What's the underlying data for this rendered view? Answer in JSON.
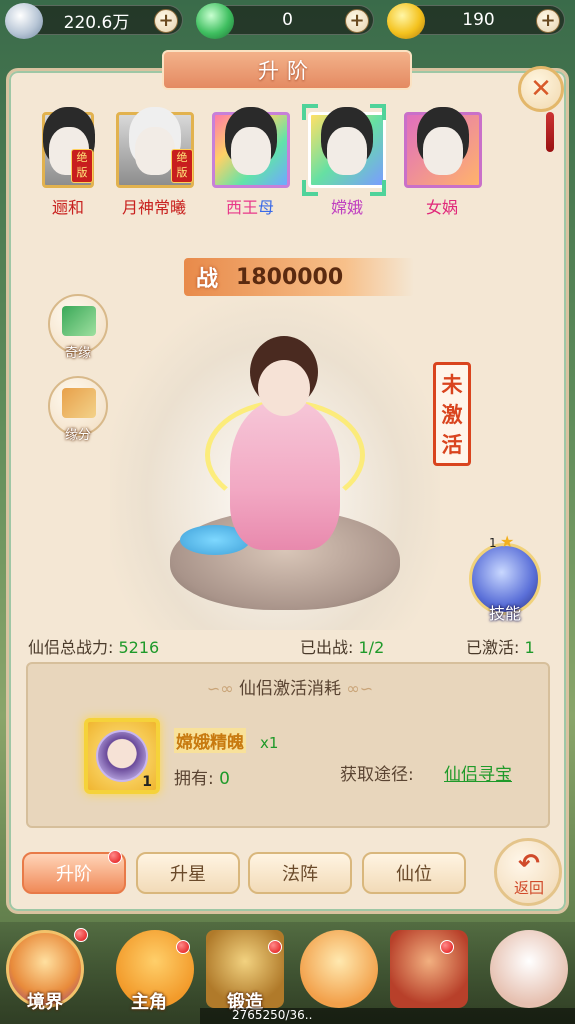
{
  "currency": {
    "silver": "220.6万",
    "jade": "0",
    "gold": "190"
  },
  "title": "升阶",
  "close_icon": "close-x",
  "partners": [
    {
      "name": "逦和",
      "badge": "绝版"
    },
    {
      "name": "月神常曦",
      "badge": "绝版"
    },
    {
      "name_main": "西王",
      "name_tail": "母"
    },
    {
      "name": "嫦娥"
    },
    {
      "name": "女娲"
    }
  ],
  "power": {
    "label": "战",
    "value": "1800000"
  },
  "side": {
    "qiyuan": "奇缘",
    "yuanfen": "缘分"
  },
  "status": {
    "inactive_chars": [
      "未",
      "激",
      "活"
    ]
  },
  "skill": {
    "level": "1",
    "label": "技能"
  },
  "stats": {
    "total_power_label": "仙侣总战力:",
    "total_power_value": "5216",
    "deployed_label": "已出战:",
    "deployed_value": "1/2",
    "activated_label": "已激活:",
    "activated_value": "1"
  },
  "cost": {
    "title": "仙侣激活消耗",
    "item_name": "嫦娥精魄",
    "item_count": "x1",
    "item_slot_qty": "1",
    "owned_label": "拥有:",
    "owned_value": "0",
    "source_label": "获取途径:",
    "source_link": "仙侣寻宝"
  },
  "tabs": [
    "升阶",
    "升星",
    "法阵",
    "仙位"
  ],
  "back": {
    "label": "返回",
    "icon": "back-arrow"
  },
  "bottom_nav": [
    "境界",
    "主角",
    "锻造"
  ],
  "xp_text": "2765250/36..",
  "colors": {
    "accent_green": "#1f9a2a",
    "title_orange": "#e48a62",
    "stamp_red": "#d9441e"
  }
}
